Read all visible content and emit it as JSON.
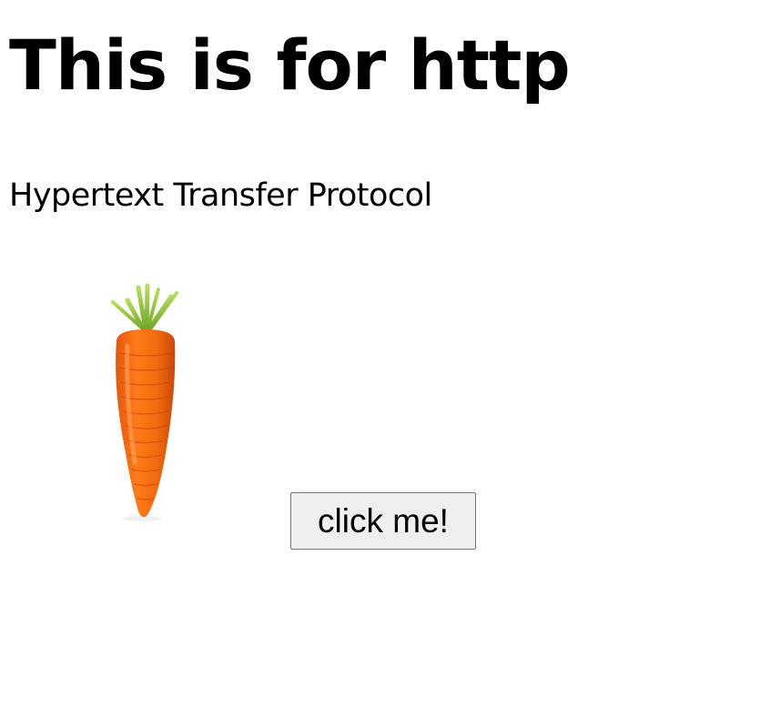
{
  "page": {
    "heading": "This is for http",
    "subheading": "Hypertext Transfer Protocol"
  },
  "image": {
    "subject": "carrot-image"
  },
  "button": {
    "label": "click me!"
  },
  "colors": {
    "carrot_orange": "#f26a0e",
    "carrot_shadow": "#c9470a",
    "leaf_green": "#8cc63a",
    "button_bg": "#efefef",
    "button_border": "#767676"
  }
}
